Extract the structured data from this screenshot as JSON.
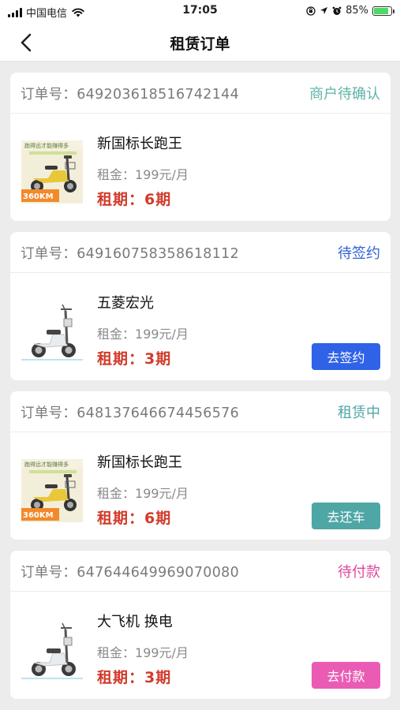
{
  "status_bar": {
    "carrier": "中国电信",
    "time": "17:05",
    "battery_percent": "85%",
    "battery_level": 0.85,
    "icons": [
      "signal-icon",
      "wifi-icon",
      "screen-lock-icon",
      "location-icon",
      "alarm-icon",
      "battery-icon"
    ]
  },
  "header": {
    "title": "租赁订单",
    "back_icon": "chevron-left-icon"
  },
  "order_no_label": "订单号：",
  "rent_label": "租金：",
  "period_label": "租期：",
  "orders": [
    {
      "order_no": "649203618516742144",
      "status": "商户待确认",
      "status_color": "#5fb3a8",
      "product_name": "新国标长跑王",
      "rent": "199元/月",
      "period": "6期",
      "image": "yellow-scooter-image",
      "action": ""
    },
    {
      "order_no": "649160758358618112",
      "status": "待签约",
      "status_color": "#2f62d8",
      "product_name": "五菱宏光",
      "rent": "199元/月",
      "period": "3期",
      "image": "white-scooter-image",
      "action": "去签约",
      "action_color": "#2f62e6"
    },
    {
      "order_no": "648137646674456576",
      "status": "租赁中",
      "status_color": "#4ea7a5",
      "product_name": "新国标长跑王",
      "rent": "199元/月",
      "period": "6期",
      "image": "yellow-scooter-image",
      "action": "去还车",
      "action_color": "#4ea7a5"
    },
    {
      "order_no": "647644649969070080",
      "status": "待付款",
      "status_color": "#e0479c",
      "product_name": "大飞机 换电",
      "rent": "199元/月",
      "period": "3期",
      "image": "white-scooter-image",
      "action": "去付款",
      "action_color": "#ea5cb4"
    }
  ],
  "colors": {
    "period_red": "#d23a2a",
    "background": "#ececec"
  }
}
